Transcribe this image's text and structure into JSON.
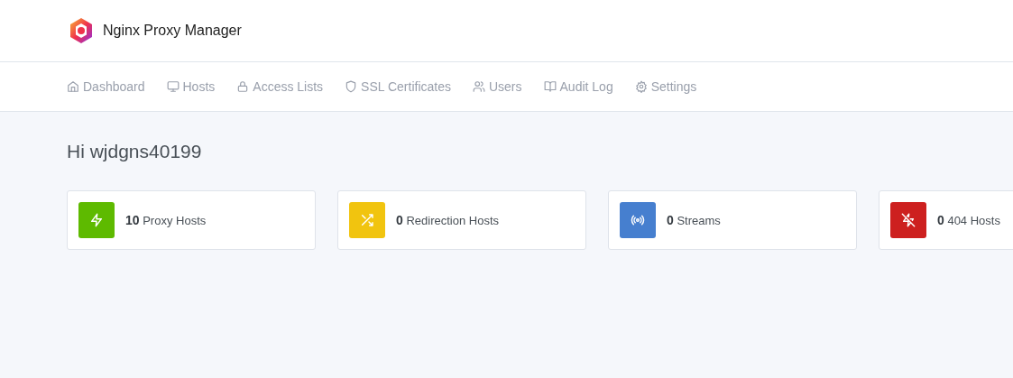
{
  "header": {
    "title": "Nginx Proxy Manager"
  },
  "nav": [
    {
      "label": "Dashboard",
      "kind": "home"
    },
    {
      "label": "Hosts",
      "kind": "monitor"
    },
    {
      "label": "Access Lists",
      "kind": "lock"
    },
    {
      "label": "SSL Certificates",
      "kind": "shield"
    },
    {
      "label": "Users",
      "kind": "users"
    },
    {
      "label": "Audit Log",
      "kind": "book"
    },
    {
      "label": "Settings",
      "kind": "gear"
    }
  ],
  "greeting": "Hi wjdgns40199",
  "cards": [
    {
      "count": "10",
      "label": "Proxy Hosts",
      "kind": "bolt",
      "color": "#5eba00"
    },
    {
      "count": "0",
      "label": "Redirection Hosts",
      "kind": "shuffle",
      "color": "#f1c40f"
    },
    {
      "count": "0",
      "label": "Streams",
      "kind": "radio",
      "color": "#467fcf"
    },
    {
      "count": "0",
      "label": "404 Hosts",
      "kind": "zapoff",
      "color": "#cd201f"
    }
  ]
}
